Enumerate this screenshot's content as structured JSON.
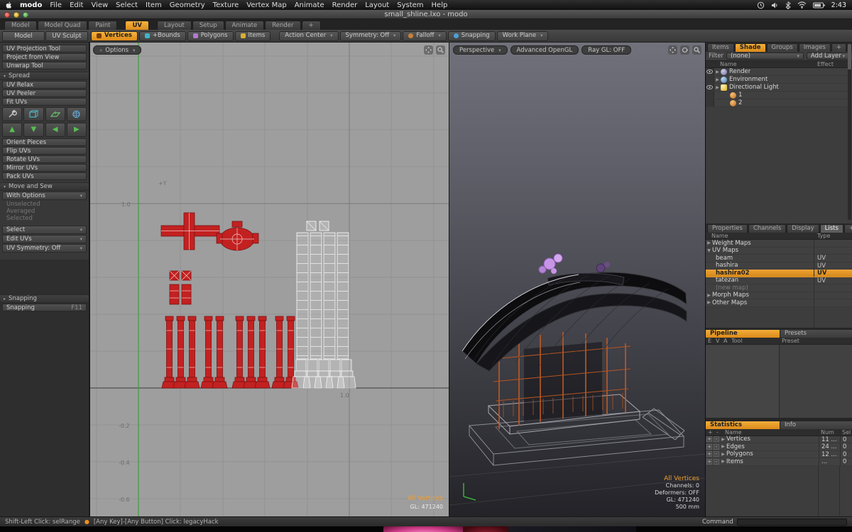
{
  "menubar": {
    "app_name": "modo",
    "menus": [
      "File",
      "Edit",
      "View",
      "Select",
      "Item",
      "Geometry",
      "Texture",
      "Vertex Map",
      "Animate",
      "Render",
      "Layout",
      "System",
      "Help"
    ],
    "clock": "2:43"
  },
  "titlebar": {
    "title": "small_shline.lxo - modo"
  },
  "layout_tabs": {
    "tabs": [
      {
        "label": "Model"
      },
      {
        "label": "Model Quad"
      },
      {
        "label": "Paint"
      },
      {
        "label": "UV"
      },
      {
        "label": "Layout"
      },
      {
        "label": "Setup"
      },
      {
        "label": "Animate"
      },
      {
        "label": "Render"
      },
      {
        "label": "+"
      }
    ]
  },
  "toolbar": {
    "mode_tabs": [
      {
        "label": "Model"
      },
      {
        "label": "UV Sculpt"
      }
    ],
    "selection": [
      {
        "label": "Vertices"
      },
      {
        "label": "+Bounds"
      },
      {
        "label": "Polygons"
      },
      {
        "label": "Items"
      }
    ],
    "action_center": "Action Center",
    "symmetry": "Symmetry: Off",
    "falloff": "Falloff",
    "snapping": "Snapping",
    "work_plane": "Work Plane"
  },
  "sidebar": {
    "top_buttons": [
      "UV Projection Tool",
      "Project from View",
      "Unwrap Tool"
    ],
    "spread_header": "Spread",
    "spread_buttons": [
      "UV Relax",
      "UV Peeler",
      "Fit UVs"
    ],
    "orient_buttons": [
      "Orient Pieces",
      "Flip UVs",
      "Rotate UVs",
      "Mirror UVs",
      "Pack UVs"
    ],
    "move_sew_header": "Move and Sew",
    "with_options": "With Options",
    "disabled": [
      "Unselected",
      "Averaged",
      "Selected"
    ],
    "selection_dropdowns": [
      "Select",
      "Edit UVs",
      "UV Symmetry: Off"
    ],
    "snapping_header": "Snapping",
    "snapping_button": "Snapping",
    "snapping_key": "F11"
  },
  "uv_viewport": {
    "options_label": "Options",
    "labels": {
      "axis_y": "+Y",
      "v_top": "1.0",
      "u_right": "1.0",
      "neg1": "-0.2",
      "neg2": "-0.4",
      "neg3": "-0.6"
    },
    "overlay": {
      "mode": "All Vertices",
      "gl": "GL: 471240"
    }
  },
  "viewport3d": {
    "perspective": "Perspective",
    "advanced_gl": "Advanced OpenGL",
    "raygl": "Ray GL: OFF",
    "overlay": {
      "mode": "All Vertices",
      "channels": "Channels: 0",
      "deformers": "Deformers: OFF",
      "gl": "GL: 471240",
      "scale": "500 mm"
    }
  },
  "right_panel": {
    "top_tabs": [
      {
        "label": "Items"
      },
      {
        "label": "Shade ..."
      },
      {
        "label": "Groups"
      },
      {
        "label": "Images"
      },
      {
        "label": "+"
      }
    ],
    "filter_label": "Filter",
    "filter_value": "(none)",
    "add_layer": "Add Layer",
    "shader_cols": {
      "name": "Name",
      "effect": "Effect"
    },
    "shader_rows": [
      {
        "label": "Render"
      },
      {
        "label": "Environment"
      },
      {
        "label": "Directional Light"
      },
      {
        "label": "1"
      },
      {
        "label": "2"
      }
    ],
    "mid_tabs": [
      {
        "label": "Properties"
      },
      {
        "label": "Channels"
      },
      {
        "label": "Display"
      },
      {
        "label": "Lists"
      },
      {
        "label": "+"
      }
    ],
    "lists_cols": {
      "name": "Name",
      "type": "Type"
    },
    "lists_rows": [
      {
        "label": "Weight Maps",
        "type": ""
      },
      {
        "label": "UV Maps",
        "type": ""
      },
      {
        "label": "beam",
        "type": "UV"
      },
      {
        "label": "hashira",
        "type": "UV"
      },
      {
        "label": "hashira02",
        "type": "UV"
      },
      {
        "label": "tatezan",
        "type": "UV"
      },
      {
        "label": "(new map)",
        "type": ""
      },
      {
        "label": "Morph Maps",
        "type": ""
      },
      {
        "label": "Other Maps",
        "type": ""
      }
    ],
    "pipeline": {
      "title": "Pipeline",
      "presets": "Presets",
      "col_e": "E",
      "col_v": "V",
      "col_a": "A",
      "col_tool": "Tool",
      "col_preset": "Preset"
    },
    "statistics": {
      "title": "Statistics",
      "info": "Info",
      "col_name": "Name",
      "col_num": "Num",
      "col_sel": "Sel",
      "rows": [
        {
          "name": "Vertices",
          "num": "11 ...",
          "sel": "0"
        },
        {
          "name": "Edges",
          "num": "24 ...",
          "sel": "0"
        },
        {
          "name": "Polygons",
          "num": "12 ...",
          "sel": "0"
        },
        {
          "name": "Items",
          "num": "...",
          "sel": "0"
        }
      ]
    }
  },
  "statusbar": {
    "left": "Shift-Left Click: selRange",
    "right": "[Any Key]-[Any Button] Click: legacyHack"
  },
  "command": {
    "label": "Command"
  }
}
